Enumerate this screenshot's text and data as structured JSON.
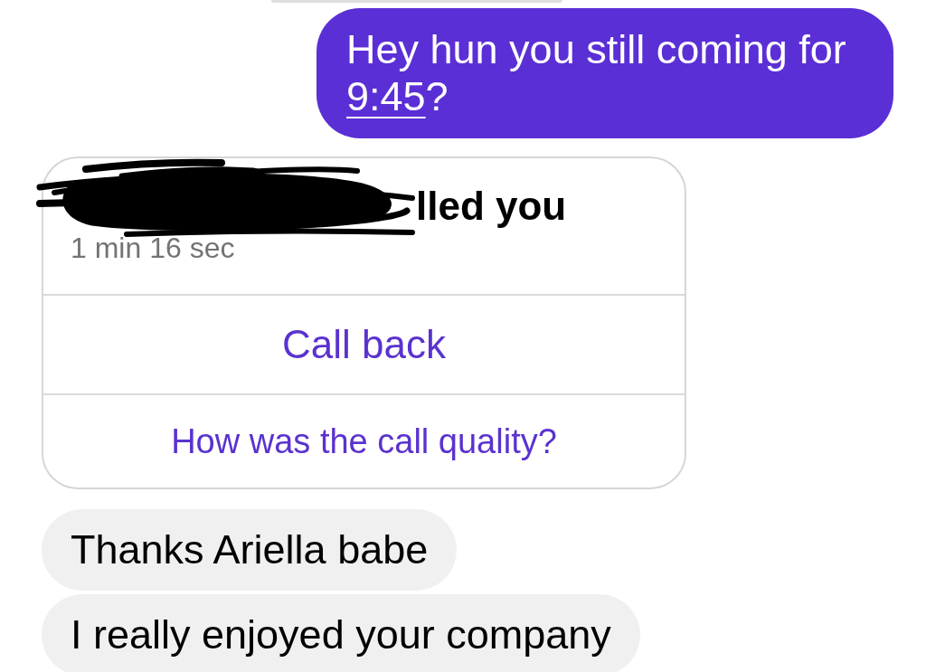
{
  "messages": [
    {
      "kind": "sent",
      "text": "Hey hun you still coming for",
      "link": "9:45",
      "after_link": "?"
    },
    {
      "kind": "call",
      "caller_redacted": true,
      "title": "lled you",
      "duration": "1 min 16 sec",
      "actions": [
        {
          "kind": "primary",
          "label": "Call back"
        },
        {
          "kind": "secondary",
          "label": "How was the call quality?"
        }
      ]
    },
    {
      "kind": "received",
      "text": "Thanks Ariella babe"
    },
    {
      "kind": "received",
      "text": "I really enjoyed your company"
    }
  ]
}
